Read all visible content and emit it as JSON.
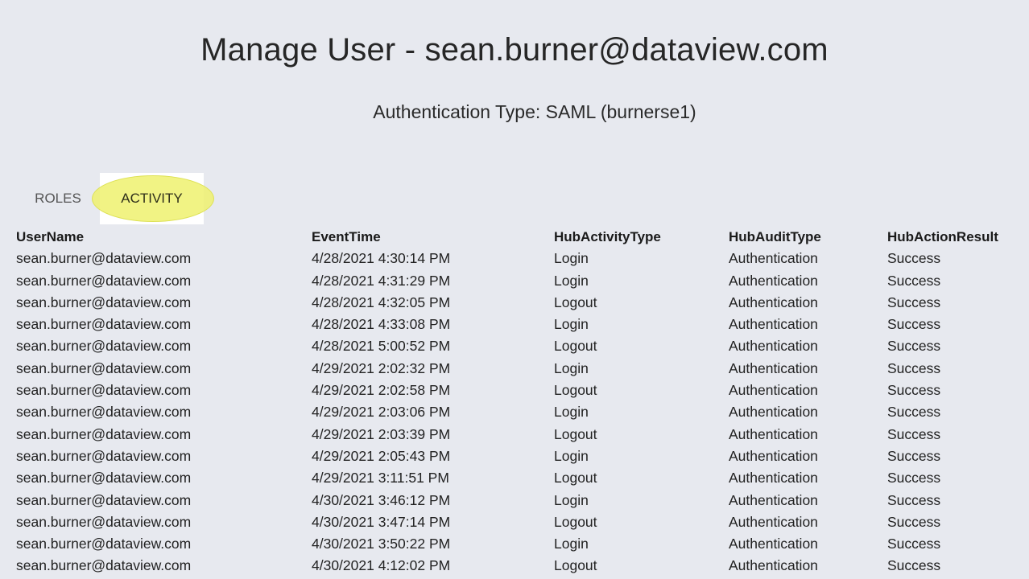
{
  "header": {
    "title": "Manage User - sean.burner@dataview.com",
    "auth_type": "Authentication Type: SAML (burnerse1)"
  },
  "tabs": [
    {
      "label": "ROLES",
      "active": false
    },
    {
      "label": "ACTIVITY",
      "active": true
    }
  ],
  "highlight_color": "#eef16e",
  "table": {
    "columns": [
      "UserName",
      "EventTime",
      "HubActivityType",
      "HubAuditType",
      "HubActionResult"
    ],
    "rows": [
      [
        "sean.burner@dataview.com",
        "4/28/2021 4:30:14 PM",
        "Login",
        "Authentication",
        "Success"
      ],
      [
        "sean.burner@dataview.com",
        "4/28/2021 4:31:29 PM",
        "Login",
        "Authentication",
        "Success"
      ],
      [
        "sean.burner@dataview.com",
        "4/28/2021 4:32:05 PM",
        "Logout",
        "Authentication",
        "Success"
      ],
      [
        "sean.burner@dataview.com",
        "4/28/2021 4:33:08 PM",
        "Login",
        "Authentication",
        "Success"
      ],
      [
        "sean.burner@dataview.com",
        "4/28/2021 5:00:52 PM",
        "Logout",
        "Authentication",
        "Success"
      ],
      [
        "sean.burner@dataview.com",
        "4/29/2021 2:02:32 PM",
        "Login",
        "Authentication",
        "Success"
      ],
      [
        "sean.burner@dataview.com",
        "4/29/2021 2:02:58 PM",
        "Logout",
        "Authentication",
        "Success"
      ],
      [
        "sean.burner@dataview.com",
        "4/29/2021 2:03:06 PM",
        "Login",
        "Authentication",
        "Success"
      ],
      [
        "sean.burner@dataview.com",
        "4/29/2021 2:03:39 PM",
        "Logout",
        "Authentication",
        "Success"
      ],
      [
        "sean.burner@dataview.com",
        "4/29/2021 2:05:43 PM",
        "Login",
        "Authentication",
        "Success"
      ],
      [
        "sean.burner@dataview.com",
        "4/29/2021 3:11:51 PM",
        "Logout",
        "Authentication",
        "Success"
      ],
      [
        "sean.burner@dataview.com",
        "4/30/2021 3:46:12 PM",
        "Login",
        "Authentication",
        "Success"
      ],
      [
        "sean.burner@dataview.com",
        "4/30/2021 3:47:14 PM",
        "Logout",
        "Authentication",
        "Success"
      ],
      [
        "sean.burner@dataview.com",
        "4/30/2021 3:50:22 PM",
        "Login",
        "Authentication",
        "Success"
      ],
      [
        "sean.burner@dataview.com",
        "4/30/2021 4:12:02 PM",
        "Logout",
        "Authentication",
        "Success"
      ]
    ]
  }
}
